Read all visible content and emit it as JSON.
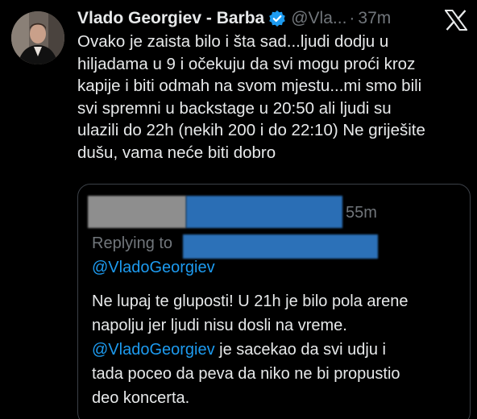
{
  "tweet": {
    "author": {
      "display_name": "Vlado Georgiev - Barba",
      "handle": "@Vla...",
      "verified": true
    },
    "separator": "·",
    "time": "37m",
    "text_lines": [
      "Ovako je zaista bilo i šta sad...ljudi dodju u",
      "hiljadama u 9 i očekuju da svi mogu proći kroz",
      "kapije i biti odmah na svom mjestu...mi smo bili",
      "svi spremni u backstage u 20:50 ali ljudi su",
      "ulazili do 22h (nekih 200 i do 22:10) Ne griješite",
      "dušu, vama neće biti dobro"
    ]
  },
  "quoted_tweet": {
    "time": "55m",
    "replying_to_label": "Replying to",
    "replying_mention": "@VladoGeorgiev",
    "text_line_1": "Ne lupaj te gluposti! U 21h je bilo pola arene",
    "text_line_2": "napolju jer ljudi nisu dosli na vreme.",
    "text_line_3_mention": "@VladoGeorgiev",
    "text_line_3_rest": " je sacekao da svi udju i",
    "text_line_4": "tada poceo da peva da niko ne bi propustio",
    "text_line_5": "deo koncerta."
  },
  "icons": {
    "verified": "verified-badge-icon",
    "platform": "x-logo-icon"
  },
  "colors": {
    "background": "#000000",
    "text": "#e7e9ea",
    "secondary": "#71767b",
    "accent": "#1d9bf0",
    "border": "#3b4047"
  }
}
